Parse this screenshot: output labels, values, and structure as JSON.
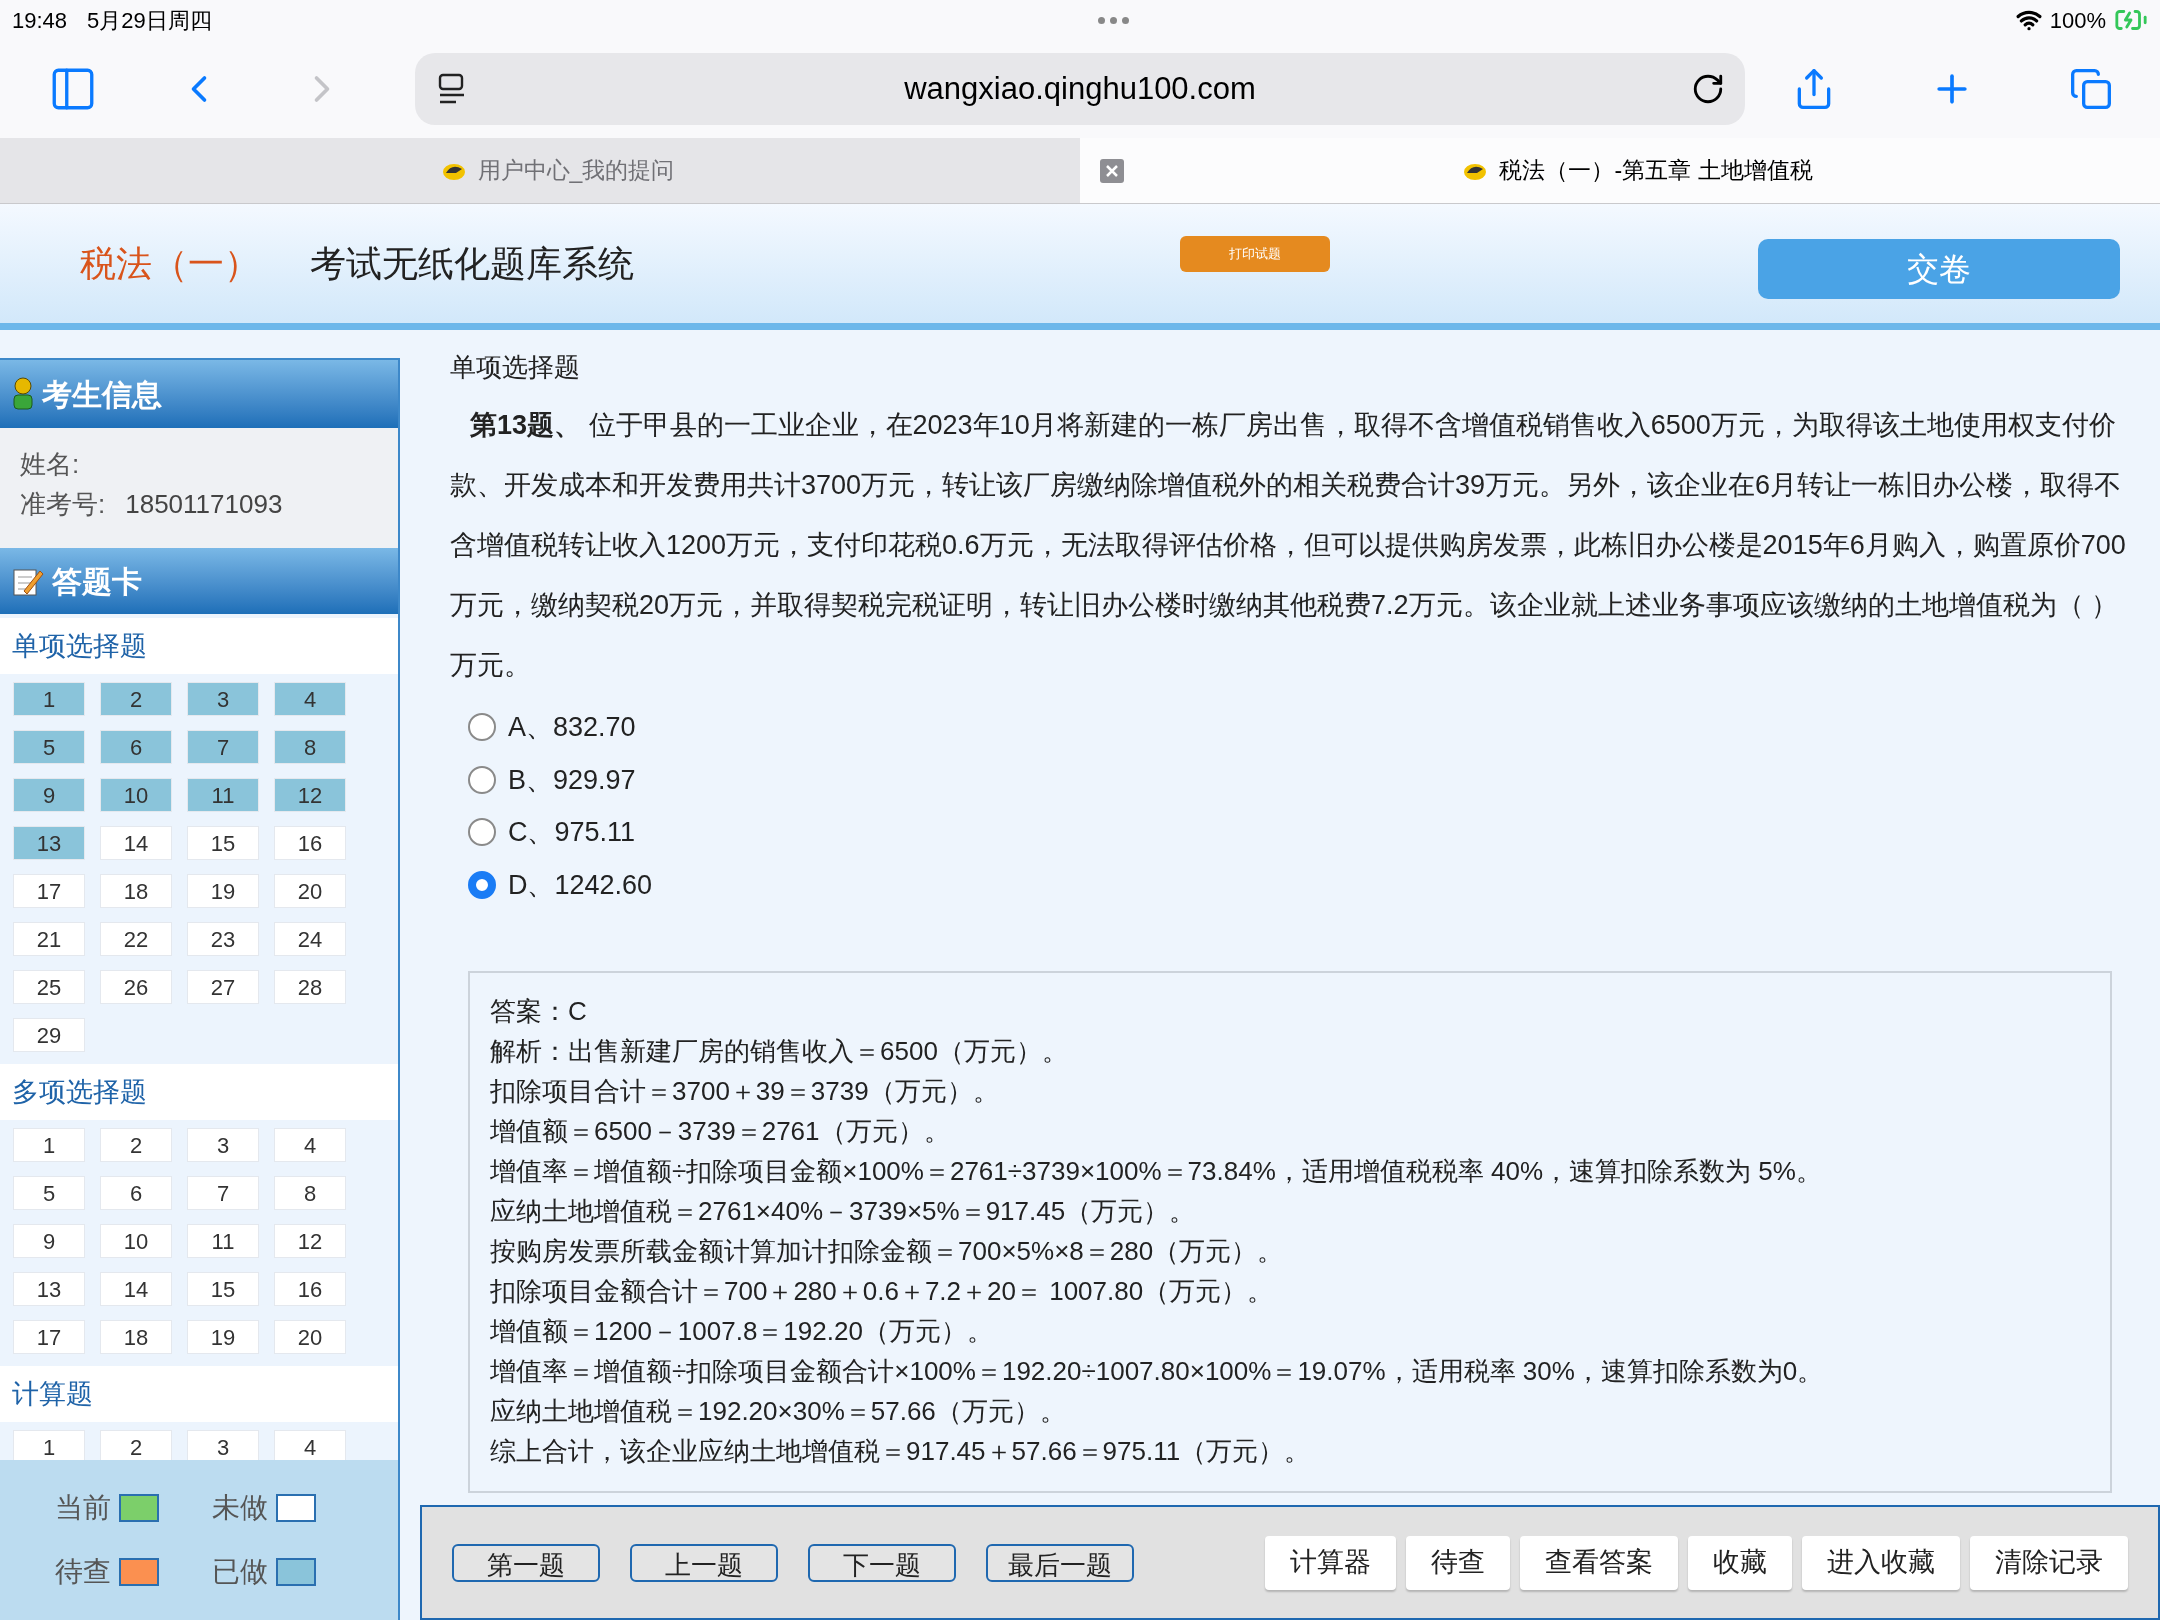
{
  "status_bar": {
    "time": "19:48",
    "date": "5月29日周四",
    "battery": "100%"
  },
  "browser": {
    "url": "wangxiao.qinghu100.com",
    "forward_disabled": true,
    "tabs": [
      {
        "title": "用户中心_我的提问",
        "selected": false
      },
      {
        "title": "税法（一）-第五章 土地增值税",
        "selected": true
      }
    ]
  },
  "header": {
    "subject": "税法（一）",
    "system_title": "考试无纸化题库系统",
    "print_button": "打印试题",
    "submit_button": "交卷"
  },
  "sidebar": {
    "info_title": "考生信息",
    "name_label": "姓名:",
    "exam_no_label": "准考号:",
    "exam_no": "18501171093",
    "card_title": "答题卡",
    "sections": [
      {
        "title": "单项选择题",
        "items": [
          {
            "label": "1",
            "answered": true
          },
          {
            "label": "2",
            "answered": true
          },
          {
            "label": "3",
            "answered": true
          },
          {
            "label": "4",
            "answered": true
          },
          {
            "label": "5",
            "answered": true
          },
          {
            "label": "6",
            "answered": true
          },
          {
            "label": "7",
            "answered": true
          },
          {
            "label": "8",
            "answered": true
          },
          {
            "label": "9",
            "answered": true
          },
          {
            "label": "10",
            "answered": true
          },
          {
            "label": "11",
            "answered": true
          },
          {
            "label": "12",
            "answered": true
          },
          {
            "label": "13",
            "answered": true
          },
          {
            "label": "14",
            "answered": false
          },
          {
            "label": "15",
            "answered": false
          },
          {
            "label": "16",
            "answered": false
          },
          {
            "label": "17",
            "answered": false
          },
          {
            "label": "18",
            "answered": false
          },
          {
            "label": "19",
            "answered": false
          },
          {
            "label": "20",
            "answered": false
          },
          {
            "label": "21",
            "answered": false
          },
          {
            "label": "22",
            "answered": false
          },
          {
            "label": "23",
            "answered": false
          },
          {
            "label": "24",
            "answered": false
          },
          {
            "label": "25",
            "answered": false
          },
          {
            "label": "26",
            "answered": false
          },
          {
            "label": "27",
            "answered": false
          },
          {
            "label": "28",
            "answered": false
          },
          {
            "label": "29",
            "answered": false
          }
        ]
      },
      {
        "title": "多项选择题",
        "items": [
          {
            "label": "1",
            "answered": false
          },
          {
            "label": "2",
            "answered": false
          },
          {
            "label": "3",
            "answered": false
          },
          {
            "label": "4",
            "answered": false
          },
          {
            "label": "5",
            "answered": false
          },
          {
            "label": "6",
            "answered": false
          },
          {
            "label": "7",
            "answered": false
          },
          {
            "label": "8",
            "answered": false
          },
          {
            "label": "9",
            "answered": false
          },
          {
            "label": "10",
            "answered": false
          },
          {
            "label": "11",
            "answered": false
          },
          {
            "label": "12",
            "answered": false
          },
          {
            "label": "13",
            "answered": false
          },
          {
            "label": "14",
            "answered": false
          },
          {
            "label": "15",
            "answered": false
          },
          {
            "label": "16",
            "answered": false
          },
          {
            "label": "17",
            "answered": false
          },
          {
            "label": "18",
            "answered": false
          },
          {
            "label": "19",
            "answered": false
          },
          {
            "label": "20",
            "answered": false
          }
        ]
      },
      {
        "title": "计算题",
        "items": [
          {
            "label": "1",
            "answered": false
          },
          {
            "label": "2",
            "answered": false
          },
          {
            "label": "3",
            "answered": false
          },
          {
            "label": "4",
            "answered": false
          }
        ]
      }
    ],
    "legend": [
      {
        "label": "当前",
        "color": "#7ccf6a"
      },
      {
        "label": "未做",
        "color": "#ffffff"
      },
      {
        "label": "待查",
        "color": "#fb9050"
      },
      {
        "label": "已做",
        "color": "#8ac4da"
      }
    ]
  },
  "question": {
    "type_title": "单项选择题",
    "text": "**第13题、** 位于甲县的一工业企业，在2023年10月将新建的一栋厂房出售，取得不含增值税销售收入6500万元，为取得该土地使用权支付价款、开发成本和开发费用共计3700万元，转让该厂房缴纳除增值税外的相关税费合计39万元。另外，该企业在6月转让一栋旧办公楼，取得不含增值税转让收入1200万元，支付印花税0.6万元，无法取得评估价格，但可以提供购房发票，此栋旧办公楼是2015年6月购入，购置原价700万元，缴纳契税20万元，并取得契税完税证明，转让旧办公楼时缴纳其他税费7.2万元。该企业就上述业务事项应该缴纳的土地增值税为（    ）万元。",
    "options": [
      {
        "label": "A、832.70",
        "selected": false
      },
      {
        "label": "B、929.97",
        "selected": false
      },
      {
        "label": "C、975.11",
        "selected": false
      },
      {
        "label": "D、1242.60",
        "selected": true
      }
    ]
  },
  "answer": [
    "答案：C",
    "解析：出售新建厂房的销售收入＝6500（万元）。",
    "扣除项目合计＝3700＋39＝3739（万元）。",
    "增值额＝6500－3739＝2761（万元）。",
    "增值率＝增值额÷扣除项目金额×100%＝2761÷3739×100%＝73.84%，适用增值税税率 40%，速算扣除系数为 5%。",
    "应纳土地增值税＝2761×40%－3739×5%＝917.45（万元）。",
    "按购房发票所载金额计算加计扣除金额＝700×5%×8＝280（万元）。",
    "扣除项目金额合计＝700＋280＋0.6＋7.2＋20＝ 1007.80（万元）。",
    "增值额＝1200－1007.8＝192.20（万元）。",
    "增值率＝增值额÷扣除项目金额合计×100%＝192.20÷1007.80×100%＝19.07%，适用税率 30%，速算扣除系数为0。",
    "应纳土地增值税＝192.20×30%＝57.66（万元）。",
    "综上合计，该企业应纳土地增值税＝917.45＋57.66＝975.11（万元）。"
  ],
  "nav_buttons": [
    "第一题",
    "上一题",
    "下一题",
    "最后一题"
  ],
  "tool_buttons": [
    "计算器",
    "待查",
    "查看答案",
    "收藏",
    "进入收藏",
    "清除记录"
  ]
}
